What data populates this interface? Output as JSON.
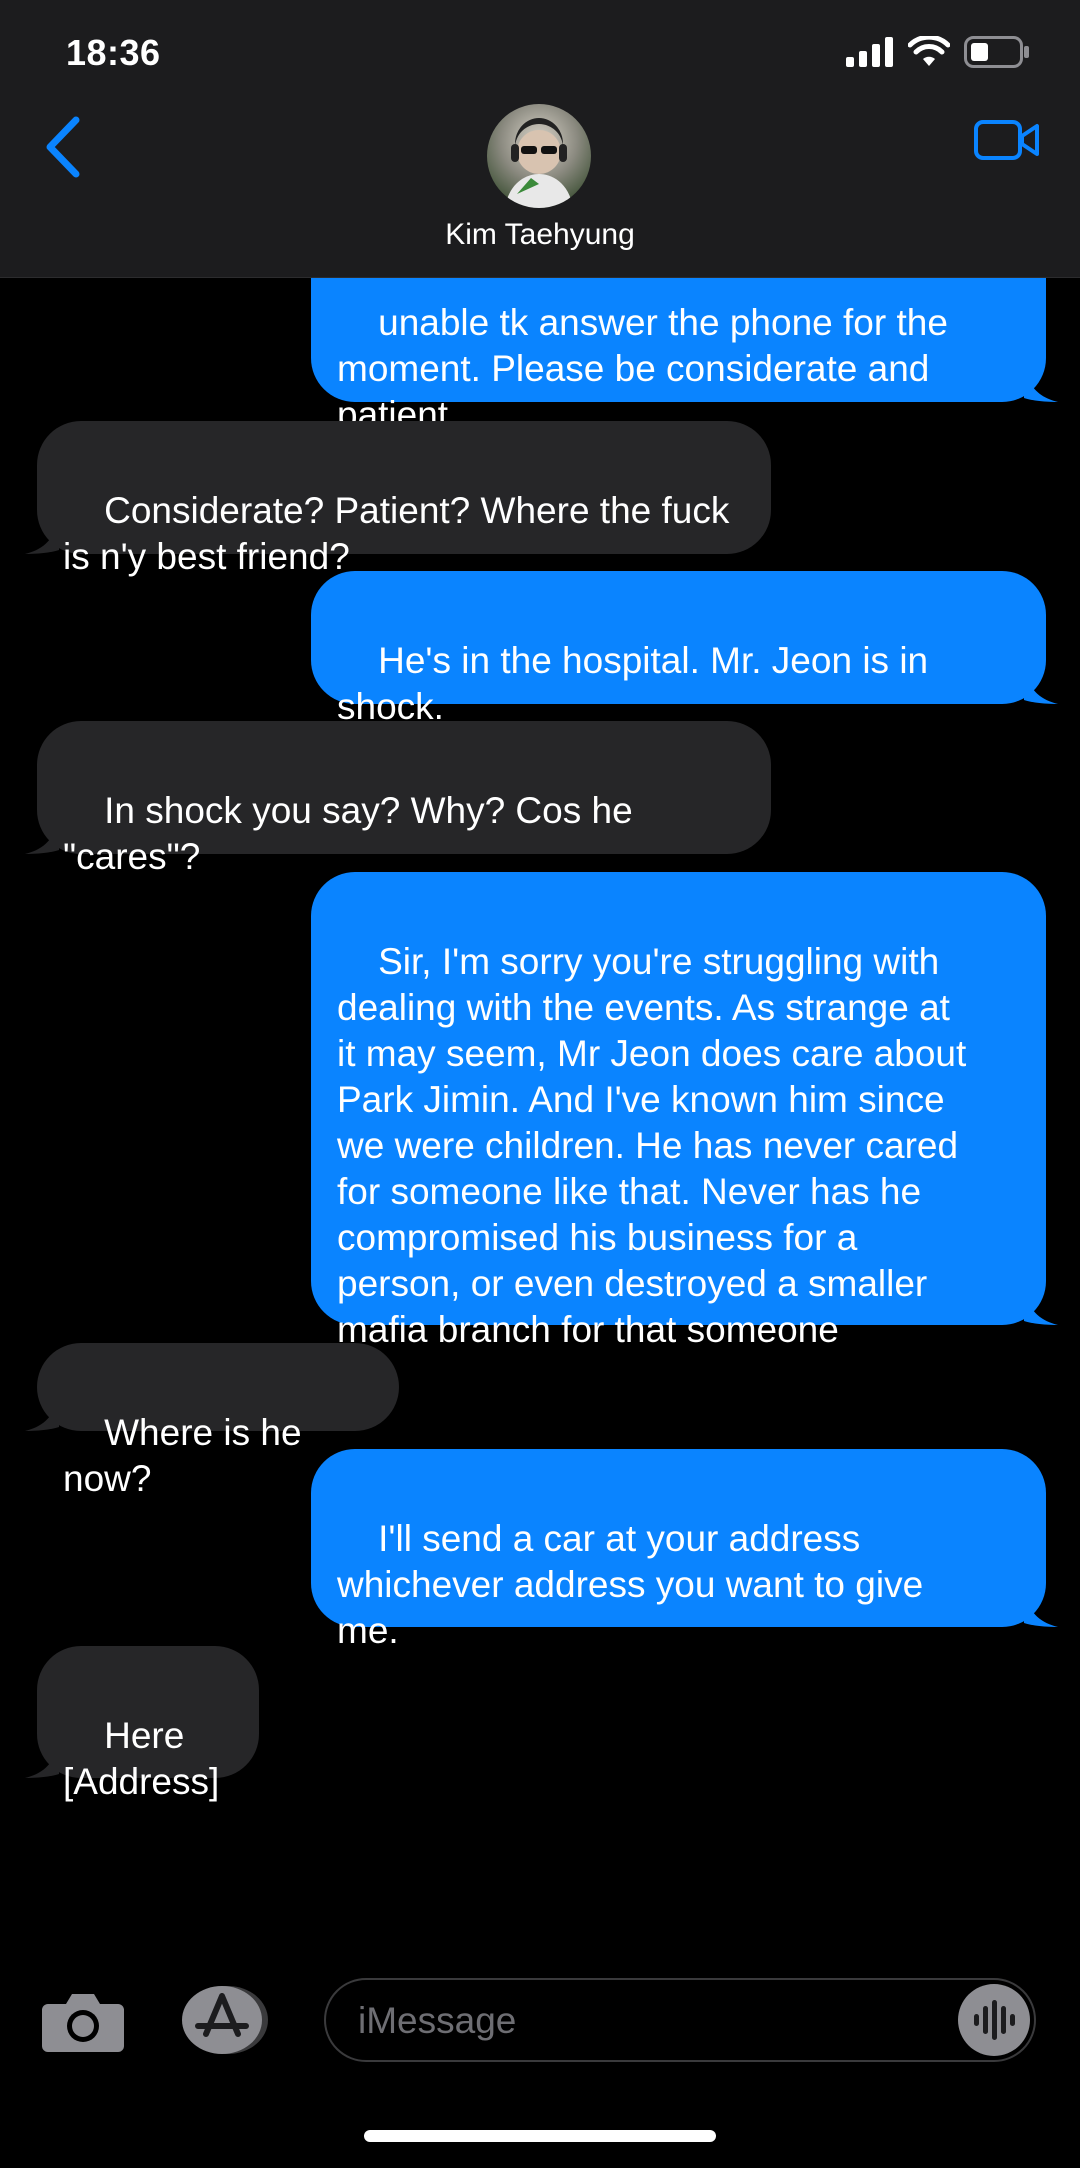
{
  "status": {
    "time": "18:36"
  },
  "header": {
    "contact_name": "Kim Taehyung",
    "back_icon": "chevron-left-icon",
    "video_icon": "video-camera-icon"
  },
  "messages": [
    {
      "from": "me",
      "text": "unable tk answer the phone for the\nmoment. Please be considerate and\npatient"
    },
    {
      "from": "them",
      "text": "Considerate? Patient? Where the fuck\nis n'y best friend?"
    },
    {
      "from": "me",
      "text": "He's in the hospital. Mr. Jeon is in\nshock."
    },
    {
      "from": "them",
      "text": "In shock you say? Why? Cos he\n\"cares\"?"
    },
    {
      "from": "me",
      "text": "Sir, I'm sorry you're struggling with\ndealing with the events. As strange at\nit may seem, Mr Jeon does care about\nPark Jimin. And I've known him since\nwe were children. He has never cared\nfor someone like that. Never has he\ncompromised his business for a\nperson, or even destroyed a smaller\nmafia branch for that someone"
    },
    {
      "from": "them",
      "text": "Where is he now?"
    },
    {
      "from": "me",
      "text": "I'll send a car at your address\nwhichever address you want to give\nme."
    },
    {
      "from": "them",
      "text": "Here\n[Address]"
    }
  ],
  "composer": {
    "placeholder": "iMessage",
    "camera_icon": "camera-icon",
    "apps_icon": "app-store-icon",
    "audio_icon": "waveform-icon"
  },
  "colors": {
    "sent_bubble": "#0a84ff",
    "received_bubble": "#262628",
    "accent": "#0a84ff"
  }
}
